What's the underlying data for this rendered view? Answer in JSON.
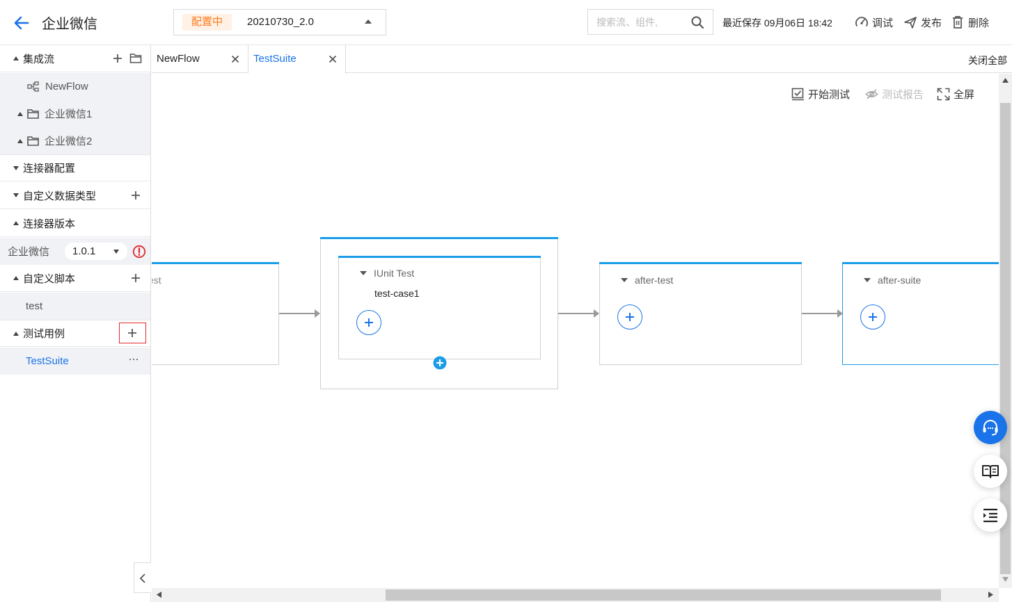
{
  "header": {
    "title": "企业微信",
    "status_badge": "配置中",
    "version": "20210730_2.0",
    "search_placeholder": "搜索流、组件,",
    "last_save": "最近保存 09月06日 18:42",
    "debug_label": "调试",
    "publish_label": "发布",
    "delete_label": "删除"
  },
  "sidebar": {
    "integration_flow_label": "集成流",
    "flows": [
      "NewFlow",
      "企业微信1",
      "企业微信2"
    ],
    "connector_config_label": "连接器配置",
    "custom_data_types_label": "自定义数据类型",
    "connector_version_label": "连接器版本",
    "connector_name": "企业微信",
    "connector_version": "1.0.1",
    "custom_scripts_label": "自定义脚本",
    "script_item": "test",
    "test_cases_label": "测试用例",
    "test_suite_item": "TestSuite",
    "more_glyph": "···"
  },
  "tabs": {
    "items": [
      "NewFlow",
      "TestSuite"
    ],
    "active": "TestSuite",
    "close_all_label": "关闭全部"
  },
  "canvas": {
    "start_test_label": "开始测试",
    "test_report_label": "测试报告",
    "fullscreen_label": "全屏",
    "node_partial_label": "est",
    "iunit_label": "IUnit Test",
    "test_case_label": "test-case1",
    "after_test_label": "after-test",
    "after_suite_label": "after-suite"
  },
  "colors": {
    "accent": "#1a73e8",
    "node_topline": "#1a9ce8",
    "status_badge_bg": "#fff1e6",
    "status_badge_text": "#ff7a1a",
    "error": "#e0282e"
  }
}
